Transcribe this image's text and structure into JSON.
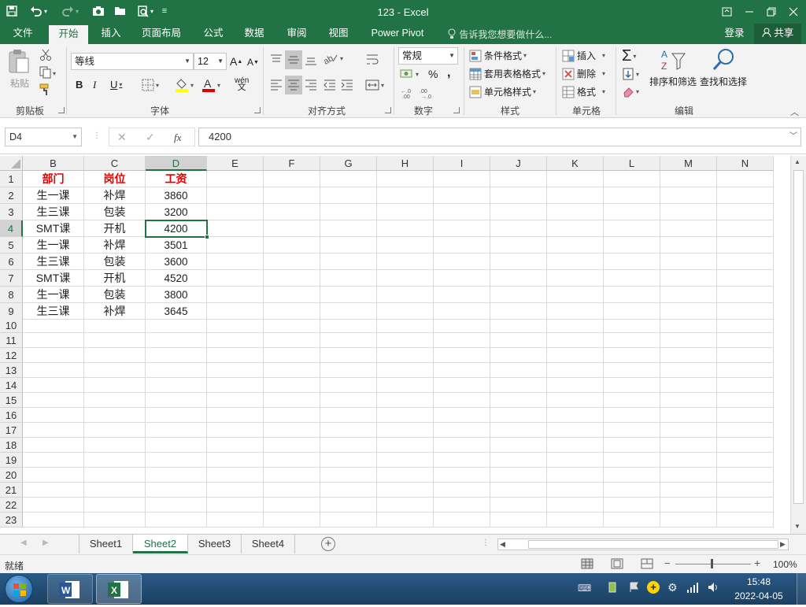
{
  "titlebar": {
    "title": "123 - Excel",
    "icons": [
      "save-icon",
      "undo-icon",
      "redo-icon",
      "camera-icon",
      "open-folder-icon",
      "print-preview-icon",
      "customize-qat-icon"
    ]
  },
  "ribbon_tabs": [
    "文件",
    "开始",
    "插入",
    "页面布局",
    "公式",
    "数据",
    "审阅",
    "视图",
    "Power Pivot"
  ],
  "tell_me": "告诉我您想要做什么...",
  "account": {
    "login": "登录",
    "share": "共享"
  },
  "ribbon": {
    "clipboard": {
      "paste": "粘贴",
      "label": "剪贴板"
    },
    "font": {
      "name": "等线",
      "size": "12",
      "bold": "B",
      "italic": "I",
      "underline": "U",
      "label": "字体",
      "font_color": "#e00000",
      "fill_color": "#ffff00"
    },
    "alignment": {
      "label": "对齐方式"
    },
    "number": {
      "format": "常规",
      "percent": "%",
      "comma": ",",
      "label": "数字"
    },
    "styles": {
      "conditional": "条件格式",
      "table": "套用表格格式",
      "cell_styles": "单元格样式",
      "label": "样式"
    },
    "cells": {
      "insert": "插入",
      "delete": "删除",
      "format": "格式",
      "label": "单元格"
    },
    "editing": {
      "sort": "排序和筛选",
      "find": "查找和选择",
      "label": "编辑"
    }
  },
  "formula_bar": {
    "name_box": "D4",
    "fx": "fx",
    "value": "4200"
  },
  "columns": [
    "B",
    "C",
    "D",
    "E",
    "F",
    "G",
    "H",
    "I",
    "J",
    "K",
    "L",
    "M",
    "N"
  ],
  "rows": [
    "1",
    "2",
    "3",
    "4",
    "5",
    "6",
    "7",
    "8",
    "9",
    "10",
    "11",
    "12",
    "13",
    "14",
    "15",
    "16",
    "17",
    "18",
    "19",
    "20",
    "21",
    "22",
    "23"
  ],
  "table": {
    "header": [
      "部门",
      "岗位",
      "工资"
    ],
    "rows": [
      [
        "生一课",
        "补焊",
        "3860"
      ],
      [
        "生三课",
        "包装",
        "3200"
      ],
      [
        "SMT课",
        "开机",
        "4200"
      ],
      [
        "生一课",
        "补焊",
        "3501"
      ],
      [
        "生三课",
        "包装",
        "3600"
      ],
      [
        "SMT课",
        "开机",
        "4520"
      ],
      [
        "生一课",
        "包装",
        "3800"
      ],
      [
        "生三课",
        "补焊",
        "3645"
      ]
    ]
  },
  "selected_cell": "D4",
  "sheets": [
    "Sheet1",
    "Sheet2",
    "Sheet3",
    "Sheet4"
  ],
  "active_sheet": "Sheet2",
  "status": {
    "ready": "就绪",
    "zoom": "100%"
  },
  "taskbar": {
    "time": "15:48",
    "date": "2022-04-05"
  },
  "colors": {
    "excel_green": "#217346",
    "header_text": "#e00000"
  }
}
